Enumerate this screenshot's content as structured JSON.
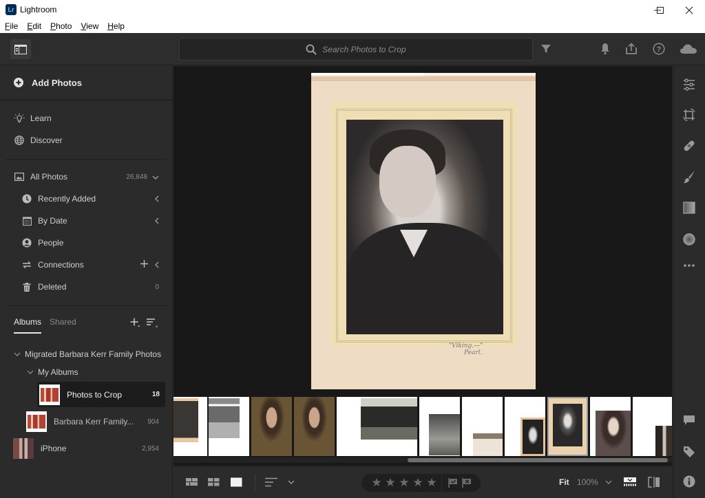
{
  "window": {
    "app_icon_text": "Lr",
    "title": "Lightroom",
    "controls": {
      "minimize": "—",
      "maximize": "☐",
      "close": "✕"
    }
  },
  "menu": [
    {
      "label": "File",
      "accel": "F",
      "rest": "ile"
    },
    {
      "label": "Edit",
      "accel": "E",
      "rest": "dit"
    },
    {
      "label": "Photo",
      "accel": "P",
      "rest": "hoto"
    },
    {
      "label": "View",
      "accel": "V",
      "rest": "iew"
    },
    {
      "label": "Help",
      "accel": "H",
      "rest": "elp"
    }
  ],
  "topbar": {
    "search_placeholder": "Search Photos to Crop",
    "icons": [
      "panel-toggle-icon",
      "search-icon",
      "filter-icon",
      "bell-icon",
      "share-icon",
      "help-icon",
      "cloud-icon"
    ]
  },
  "sidebar": {
    "add_photos": "Add Photos",
    "learn": "Learn",
    "discover": "Discover",
    "all_photos": {
      "label": "All Photos",
      "count": "26,848"
    },
    "sub_items": [
      {
        "label": "Recently Added",
        "count": ""
      },
      {
        "label": "By Date",
        "count": ""
      },
      {
        "label": "People",
        "count": ""
      },
      {
        "label": "Connections",
        "count": ""
      },
      {
        "label": "Deleted",
        "count": "0"
      }
    ],
    "tabs": {
      "albums": "Albums",
      "shared": "Shared"
    },
    "folder": "Migrated Barbara Kerr Family Photos",
    "subfolder": "My Albums",
    "albums": [
      {
        "label": "Photos to Crop",
        "count": "18",
        "selected": true
      },
      {
        "label": "Barbara Kerr Family...",
        "count": "904",
        "selected": false
      },
      {
        "label": "iPhone",
        "count": "2,954",
        "selected": false
      }
    ]
  },
  "main_photo": {
    "handwriting_line1": "\"Viking.—\"",
    "handwriting_line2": "Pearl."
  },
  "filmstrip": {
    "count": 12,
    "selected_index": 9,
    "scroll_position": 0.47
  },
  "bottombar": {
    "rating_stars": 5,
    "rating_value": 0,
    "star_glyph": "★",
    "fit_label": "Fit",
    "zoom_label": "100%"
  },
  "colors": {
    "panel_bg": "#2b2b2b",
    "canvas_bg": "#181818",
    "accent_text": "#e8e8e8",
    "muted_text": "#8a8a8a"
  }
}
